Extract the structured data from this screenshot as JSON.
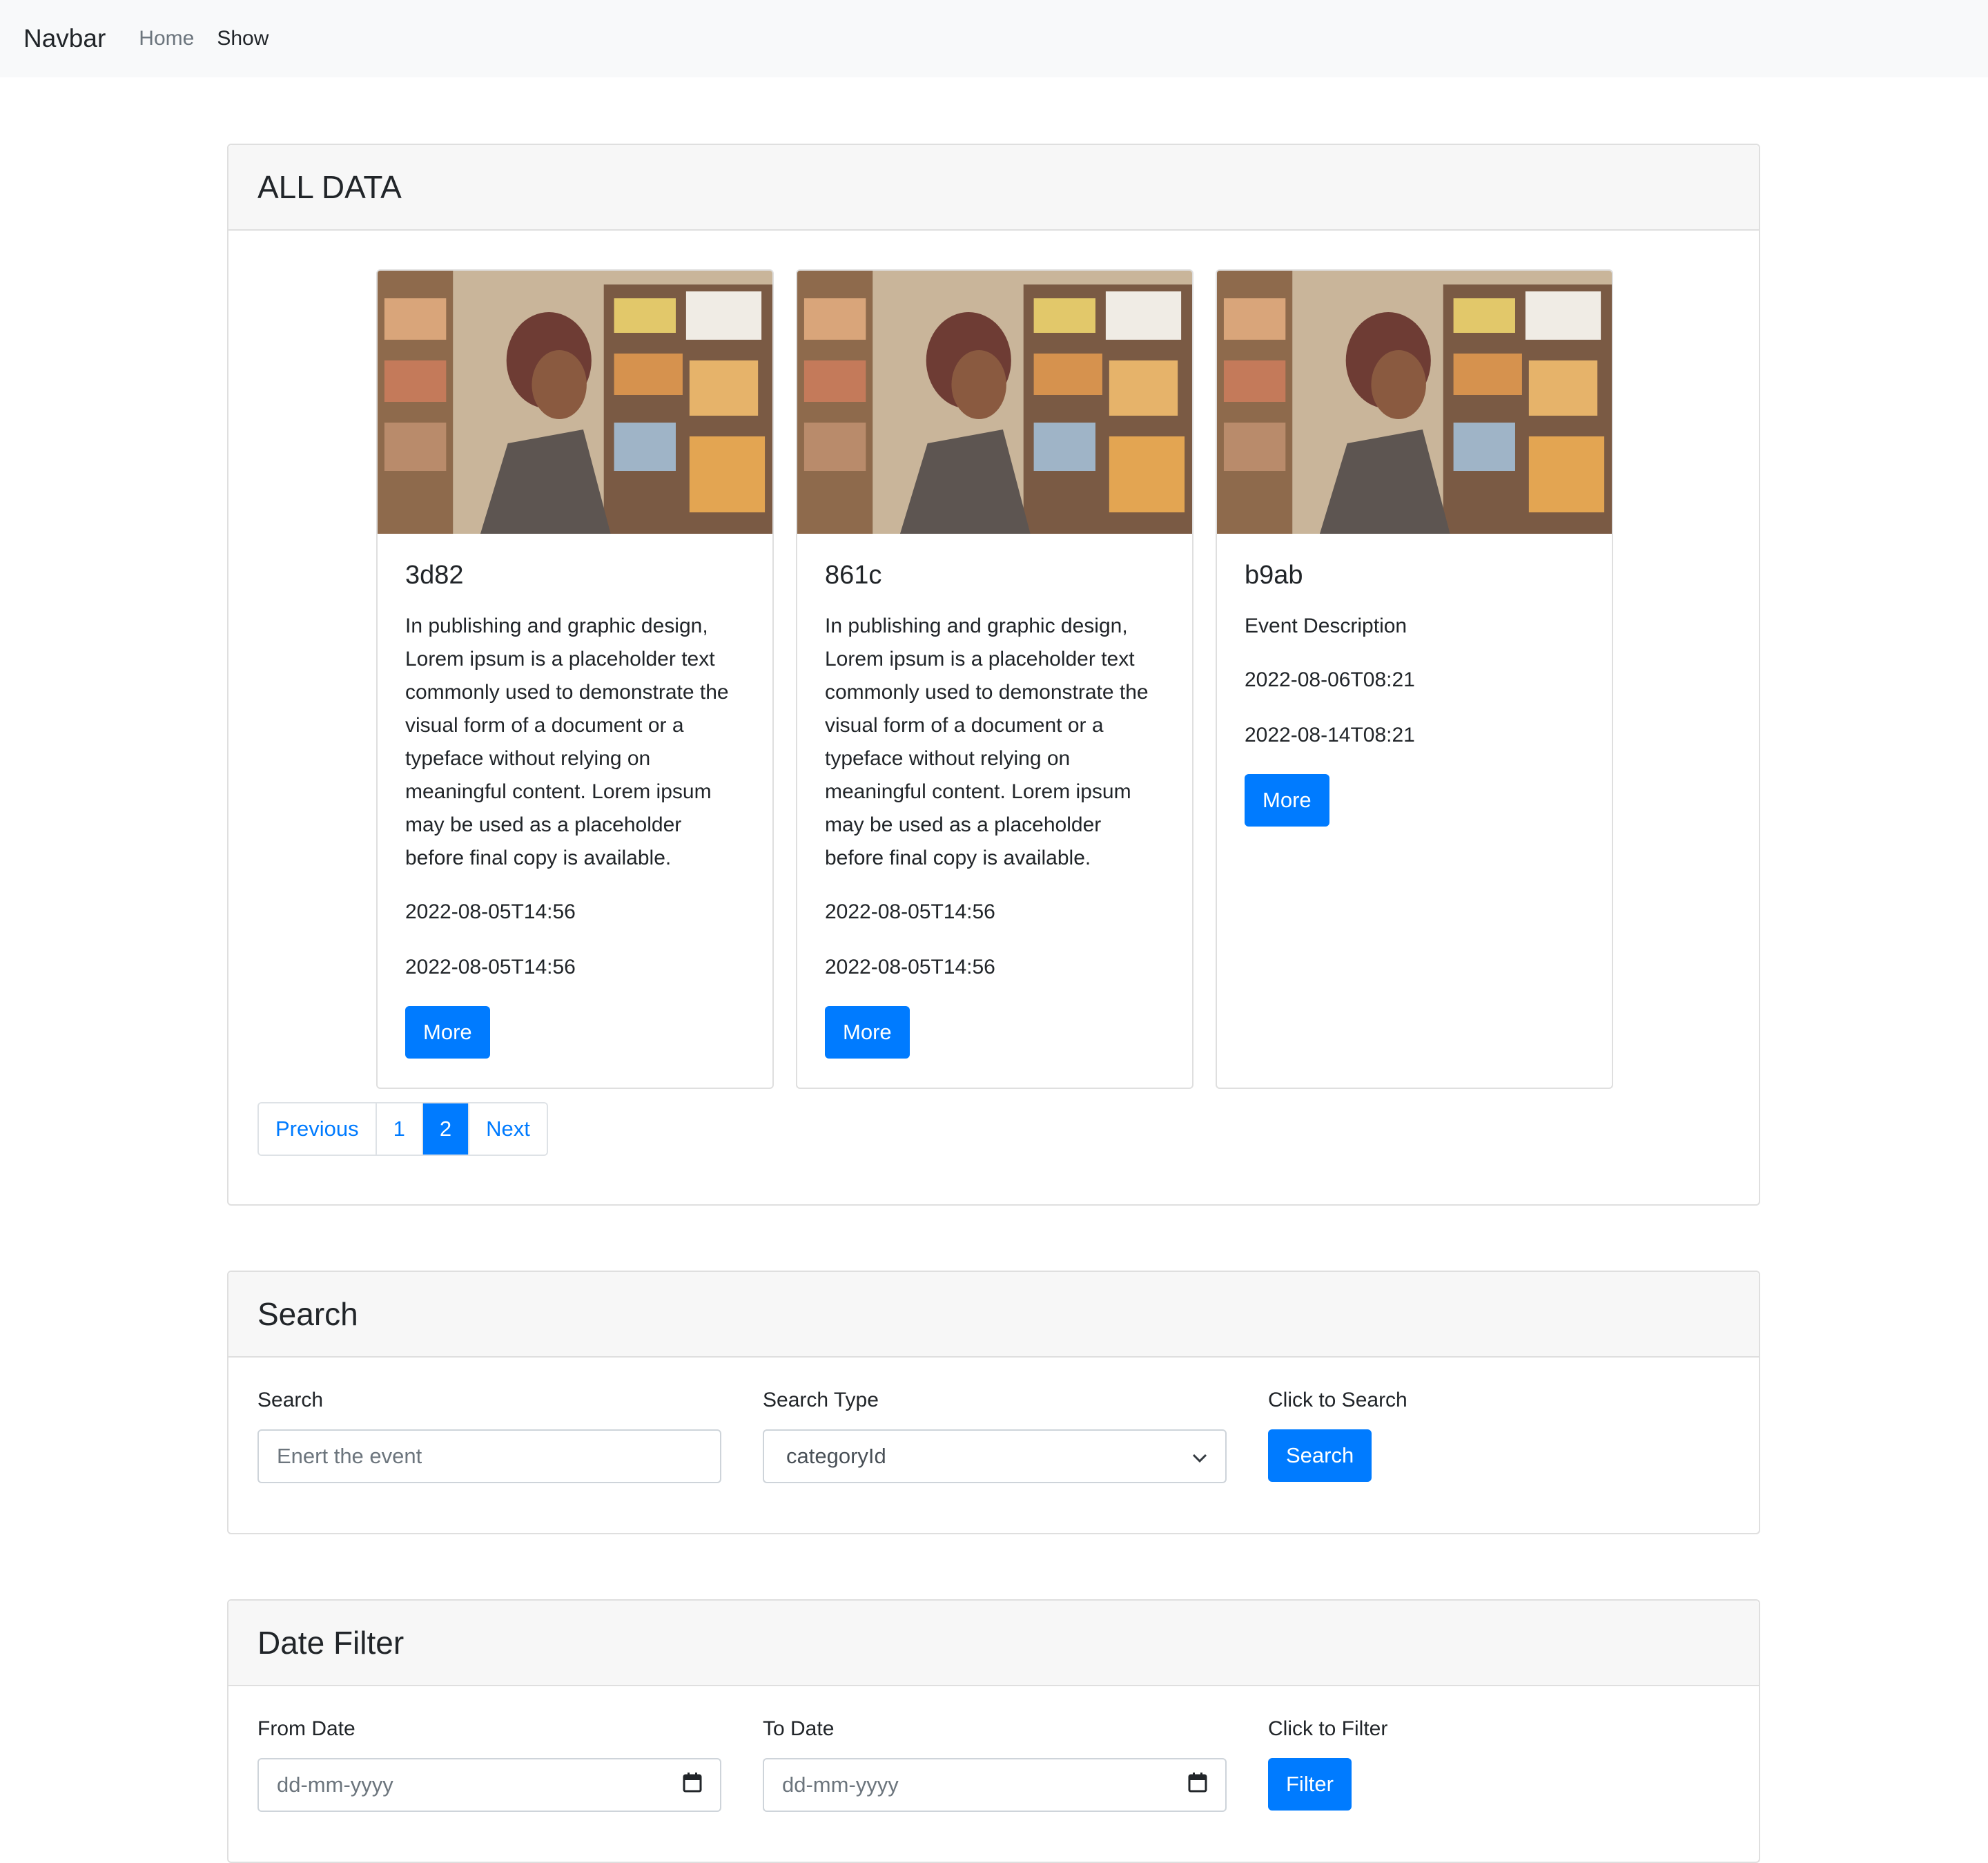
{
  "navbar": {
    "brand": "Navbar",
    "links": [
      "Home",
      "Show"
    ]
  },
  "all_data": {
    "title": "ALL DATA",
    "events": [
      {
        "id": "3d82",
        "description": "In publishing and graphic design, Lorem ipsum is a placeholder text commonly used to demonstrate the visual form of a document or a typeface without relying on meaningful content. Lorem ipsum may be used as a placeholder before final copy is available.",
        "start": "2022-08-05T14:56",
        "end": "2022-08-05T14:56",
        "button": "More"
      },
      {
        "id": "861c",
        "description": "In publishing and graphic design, Lorem ipsum is a placeholder text commonly used to demonstrate the visual form of a document or a typeface without relying on meaningful content. Lorem ipsum may be used as a placeholder before final copy is available.",
        "start": "2022-08-05T14:56",
        "end": "2022-08-05T14:56",
        "button": "More"
      },
      {
        "id": "b9ab",
        "description": "Event Description",
        "start": "2022-08-06T08:21",
        "end": "2022-08-14T08:21",
        "button": "More"
      }
    ],
    "pagination": {
      "previous": "Previous",
      "pages": [
        "1",
        "2"
      ],
      "current_page": "2",
      "next": "Next"
    }
  },
  "search": {
    "title": "Search",
    "search_label": "Search",
    "search_placeholder": "Enert the event",
    "type_label": "Search Type",
    "type_selected": "categoryId",
    "click_label": "Click to Search",
    "button": "Search"
  },
  "date_filter": {
    "title": "Date Filter",
    "from_label": "From Date",
    "from_placeholder": "dd-mm-yyyy",
    "to_label": "To Date",
    "to_placeholder": "dd-mm-yyyy",
    "click_label": "Click to Filter",
    "button": "Filter"
  },
  "colors": {
    "primary": "#007bff",
    "navbar_bg": "#f8f9fa",
    "card_header_bg": "#f7f7f7"
  }
}
